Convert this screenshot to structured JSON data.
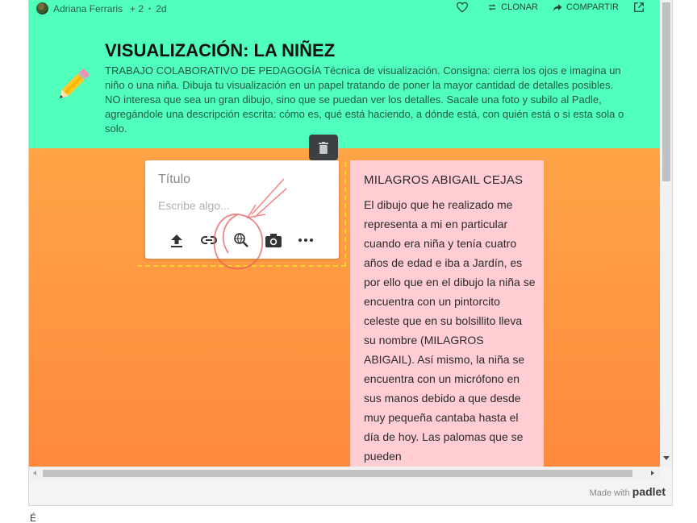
{
  "topbar": {
    "author": "Adriana Ferraris",
    "plus": "+ 2",
    "separator": "•",
    "age": "2d",
    "clone_label": "CLONAR",
    "share_label": "COMPARTIR"
  },
  "header": {
    "title": "VISUALIZACIÓN: LA NIÑEZ",
    "description": "TRABAJO COLABORATIVO DE PEDAGOGÍA Técnica de visualización. Consigna: cierra los ojos e imagina un niño o una niña. Dibuja tu visualización en un papel tratando de poner la mayor cantidad de detalles posibles. NO interesa que sea un gran dibujo, sino que se puedan ver los detalles. Sacale una foto y subilo al Padle, agregándole una descripción escrita: cómo es, qué está haciendo, a dónde está, con quién está o si esta sola o solo."
  },
  "composer": {
    "title_placeholder": "Título",
    "body_placeholder": "Escribe algo..."
  },
  "post": {
    "title": "MILAGROS ABIGAIL CEJAS",
    "text": "El dibujo que he realizado me representa a mi en particular cuando era niña y tenía cuatro años de edad e iba a Jardín, es por ello que en el dibujo la niña se encuentra con un pintorcito celeste que en su bolsillito lleva su nombre (MILAGROS ABIGAIL). Así mismo, la niña se encuentra con un micrófono en sus manos debido a que desde muy pequeña cantaba hasta el día de hoy. Las palomas que se pueden"
  },
  "footer": {
    "made_with": "Made with",
    "brand": "padlet"
  },
  "below_text": "É",
  "colors": {
    "header_bg": "#50ffbc",
    "board_top": "#ffb24b",
    "board_bottom": "#ff8a3e",
    "post_bg": "#ffcdd2",
    "annotation": "#e85a5a"
  }
}
